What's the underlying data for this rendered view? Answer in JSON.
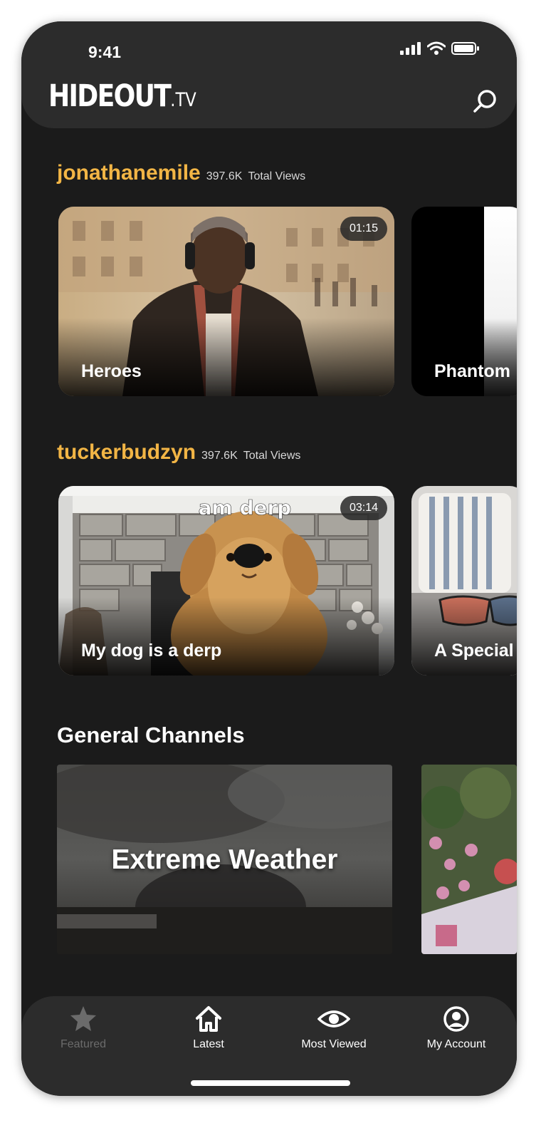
{
  "status_bar": {
    "time": "9:41"
  },
  "header": {
    "logo_main": "HIDEOUT",
    "logo_suffix": ".TV"
  },
  "sections": [
    {
      "channel": "jonathanemile",
      "views_count": "397.6K",
      "views_label": "Total Views",
      "videos": [
        {
          "title": "Heroes",
          "duration": "01:15"
        },
        {
          "title": "Phantom"
        }
      ]
    },
    {
      "channel": "tuckerbudzyn",
      "views_count": "397.6K",
      "views_label": "Total Views",
      "videos": [
        {
          "title": "My dog is a derp",
          "duration": "03:14",
          "caption": "am derp"
        },
        {
          "title": "A Special"
        }
      ]
    }
  ],
  "general": {
    "title": "General Channels",
    "items": [
      {
        "title": "Extreme Weather"
      }
    ]
  },
  "nav": [
    {
      "label": "Featured",
      "icon": "star-icon",
      "active": false
    },
    {
      "label": "Latest",
      "icon": "home-icon",
      "active": true
    },
    {
      "label": "Most Viewed",
      "icon": "eye-icon",
      "active": true
    },
    {
      "label": "My Account",
      "icon": "account-icon",
      "active": true
    }
  ],
  "colors": {
    "accent": "#f2b545",
    "background": "#1b1b1b",
    "bar": "#2c2c2c"
  }
}
